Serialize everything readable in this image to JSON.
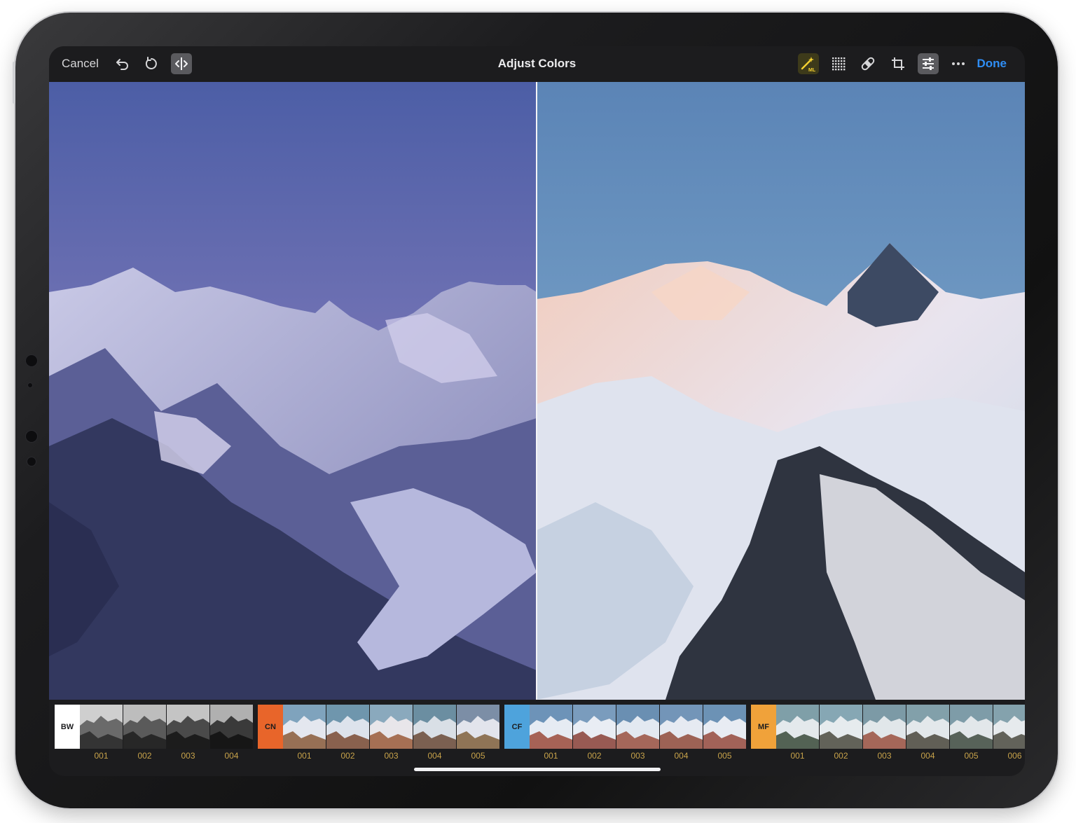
{
  "toolbar": {
    "cancel_label": "Cancel",
    "title": "Adjust Colors",
    "done_label": "Done",
    "wand_badge": "ML"
  },
  "colors": {
    "accent": "#2f8ef5",
    "frame_number": "#c7a24a",
    "tag_bw": "#ffffff",
    "tag_cn": "#e8652a",
    "tag_cf": "#4ea3dc",
    "tag_mf": "#f0a23a"
  },
  "filter_groups": [
    {
      "tag": "BW",
      "frames": [
        "001",
        "002",
        "003",
        "004"
      ]
    },
    {
      "tag": "CN",
      "frames": [
        "001",
        "002",
        "003",
        "004",
        "005"
      ]
    },
    {
      "tag": "CF",
      "frames": [
        "001",
        "002",
        "003",
        "004",
        "005"
      ]
    },
    {
      "tag": "MF",
      "frames": [
        "001",
        "002",
        "003",
        "004",
        "005",
        "006"
      ]
    }
  ],
  "icons": [
    "undo-icon",
    "reset-icon",
    "compare-icon",
    "magic-wand-ml-icon",
    "grid-filters-icon",
    "bandage-retouch-icon",
    "crop-icon",
    "adjust-sliders-icon",
    "more-icon"
  ]
}
